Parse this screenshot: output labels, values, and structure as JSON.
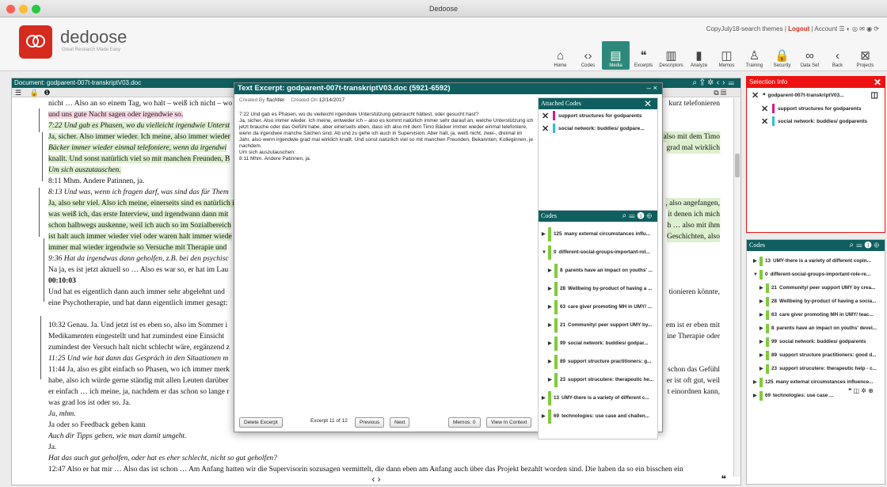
{
  "window": {
    "title": "Dedoose"
  },
  "app": {
    "logo_text": "dedoose",
    "tagline": "Great Research Made Easy"
  },
  "account_bar": {
    "project": "CopyJuly18-search themes",
    "sep1": "|",
    "logout": "Logout",
    "sep2": "|",
    "account": "Account",
    "icons": "☰ ◐ ◎ ✉ ◉ ⟳"
  },
  "toolbar": [
    {
      "label": "Home",
      "icon": "home-icon",
      "glyph": "⌂"
    },
    {
      "label": "Codes",
      "icon": "code-icon",
      "glyph": "‹›"
    },
    {
      "label": "Media",
      "icon": "media-icon",
      "glyph": "▤",
      "active": true
    },
    {
      "label": "Excerpts",
      "icon": "quote-icon",
      "glyph": "❝"
    },
    {
      "label": "Descriptors",
      "icon": "descriptor-icon",
      "glyph": "▥"
    },
    {
      "label": "Analyze",
      "icon": "chart-icon",
      "glyph": "▮"
    },
    {
      "label": "Memos",
      "icon": "memo-icon",
      "glyph": "◫"
    },
    {
      "label": "Training",
      "icon": "training-icon",
      "glyph": "♙"
    },
    {
      "label": "Security",
      "icon": "lock-icon",
      "glyph": "🔒"
    },
    {
      "label": "Data Set",
      "icon": "dataset-icon",
      "glyph": "∞"
    },
    {
      "label": "Back",
      "icon": "back-icon",
      "glyph": "‹"
    },
    {
      "label": "Projects",
      "icon": "projects-icon",
      "glyph": "⊠"
    }
  ],
  "document": {
    "title": "Document: godparent-007t-transkriptV03.doc",
    "lines": [
      {
        "text": "nicht … Also an so einem Tag, wo halt – weiß ich nicht – wo",
        "style": "plain",
        "right": "kurz telefonieren"
      },
      {
        "text": "und uns gute Nacht sagen oder irgendwie so.",
        "style": "pink"
      },
      {
        "text": "7:22 Und gab es Phasen, wo du vielleicht irgendwie Unterst",
        "style": "green-it"
      },
      {
        "text": "Ja, sicher. Also immer wieder. Ich meine, also immer wieder",
        "style": "green",
        "right": "also mit dem Timo"
      },
      {
        "text": "Bäcker immer wieder einmal telefoniere, wenn da irgendwi",
        "style": "green-it-part",
        "right": "grad mal wirklich"
      },
      {
        "text": "knallt. Und sonst natürlich viel so mit manchen Freunden, B",
        "style": "green"
      },
      {
        "text": "Um sich auszutauschen.",
        "style": "green-it"
      },
      {
        "text": "8:11 Mhm. Andere Patinnen, ja.",
        "style": "plain"
      },
      {
        "text": "8:13 Und was, wenn ich fragen darf, was sind das für Them",
        "style": "it"
      },
      {
        "text": "Ja, also sehr viel. Also ich meine, einerseits sind es natürlich i",
        "style": "green",
        "right": ", also angefangen,"
      },
      {
        "text": "was weiß ich, das erste Interview, und irgendwann dann mit",
        "style": "green",
        "right": "it denen ich mich"
      },
      {
        "text": "schon halbwegs auskenne, weil ich auch so im Sozialbereich",
        "style": "green",
        "right": "h … also mit ihm"
      },
      {
        "text": "ist halt auch immer wieder viel oder waren halt immer wiede",
        "style": "green",
        "right": "Geschichten, also"
      },
      {
        "text": "immer mal wieder irgendwie so Versuche mit Therapie und",
        "style": "green"
      },
      {
        "text": "9:36 Hat da irgendwas dann geholfen, z.B. bei den psychisc",
        "style": "it"
      },
      {
        "text": "Na ja, es ist jetzt aktuell so … Also es war so, er hat im Lau",
        "style": "plain"
      },
      {
        "text": "00:10:03",
        "style": "bold"
      },
      {
        "text": "Und hat es eigentlich dann auch immer sehr abgelehnt und",
        "style": "plain",
        "right": "tionieren könnte,"
      },
      {
        "text": "eine Psychotherapie, und hat dann eigentlich immer gesagt:",
        "style": "plain"
      },
      {
        "text": "",
        "style": "plain"
      },
      {
        "text": "10:32 Genau. Ja. Und jetzt ist es eben so, also im Sommer i",
        "style": "plain",
        "right": "em ist er eben mit"
      },
      {
        "text": "Medikamenten eingestellt und hat zumindest eine Einsicht",
        "style": "plain",
        "right": "ine Therapie oder"
      },
      {
        "text": "zumindest der Versuch halt nicht schlecht wäre, ergänzend z",
        "style": "plain"
      },
      {
        "text": "11:25 Und wie hat dann das Gespräch in den Situationen m",
        "style": "it"
      },
      {
        "text": "11:44 Ja, also es gibt einfach so Phasen, wo ich immer merk",
        "style": "plain",
        "right": "schon das Gefühl"
      },
      {
        "text": "habe, also ich würde gerne ständig mit allen Leuten darüber",
        "style": "plain",
        "right": "er ist oft gut, weil"
      },
      {
        "text": "er einfach … ich meine, ja, nachdem er das schon so lange r",
        "style": "plain",
        "right": "t einordnen kann,"
      },
      {
        "text": "was grad los ist oder so. Ja.",
        "style": "plain"
      },
      {
        "text": "Ja, mhm.",
        "style": "it"
      },
      {
        "text": "Ja oder so Feedback geben kann",
        "style": "plain"
      },
      {
        "text": "Auch dir Tipps geben, wie man damit umgeht.",
        "style": "it"
      },
      {
        "text": "Ja.",
        "style": "plain"
      },
      {
        "text": "Hat das auch gut geholfen, oder hat es eher schlecht, nicht so gut geholfen?",
        "style": "it"
      },
      {
        "text": "12:47 Also er hat mir … Also das ist schon … Am Anfang hatten wir die Supervisorin sozusagen vermittelt, die dann eben am Anfang auch über das Projekt bezahlt worden sind. Die haben da so ein bisschen ein",
        "style": "plain"
      }
    ],
    "pager": "‹   ›",
    "quote_icon": "❝"
  },
  "excerpt": {
    "title": "Text Excerpt:  godparent-007t-transkriptV03.doc (5921-6592)",
    "controls": "– ×",
    "created_by_label": "Created By",
    "created_by": "ftachtler",
    "created_on_label": "Created On",
    "created_on": "12/14/2017",
    "text": "7:22 Und gab es Phasen, wo du vielleicht irgendwie Unterstützung gebraucht hättest, oder gesucht hast?\nJa, sicher. Also immer wieder. Ich meine, entweder ich – also es kommt natürlich immer sehr darauf an, welche Unterstützung ich jetzt brauche oder das Gefühl habe, aber einerseits eben, dass ich also mit dem Timo Bäcker immer wieder einmal telefoniere, wenn da irgendwie manche Sachen sind. Ab und zu gehe ich auch in Supervision. Aber halt, ja, weiß nicht, zwei-, dreimal im Jahr, also wenn irgendwie grad mal wirklich knallt. Und sonst natürlich viel so mit manchen Freunden, Bekannten, Kolleginnen, je nachdem.\nUm sich auszutauschen.\n8:11 Mhm. Andere Patinnen, ja.",
    "attached_title": "Attached Codes",
    "attached": [
      {
        "label": "support structures for godparents",
        "color": "#d41a8a"
      },
      {
        "label": "social network: buddies/ godpare...",
        "color": "#2bc0d8"
      }
    ],
    "codes_title": "Codes",
    "codes": [
      {
        "count": "125",
        "label": "many external circumstances influ...",
        "indent": 0,
        "open": false
      },
      {
        "count": "0",
        "label": "different-social-groups-important-rol...",
        "indent": 0,
        "open": true
      },
      {
        "count": "8",
        "label": "parents have an impact on youths' ...",
        "indent": 1,
        "open": false
      },
      {
        "count": "28",
        "label": "Wellbeing by-product of having a ...",
        "indent": 1,
        "open": false
      },
      {
        "count": "63",
        "label": "care giver promoting MH in UMY/ ...",
        "indent": 1,
        "open": false
      },
      {
        "count": "21",
        "label": "Community/ peer support UMY by...",
        "indent": 1,
        "open": false
      },
      {
        "count": "99",
        "label": "social network: buddies/ godpar...",
        "indent": 1,
        "open": false
      },
      {
        "count": "89",
        "label": "support structure practitioners: g...",
        "indent": 1,
        "open": false
      },
      {
        "count": "23",
        "label": "support strucutere: therapeutic he...",
        "indent": 1,
        "open": false
      },
      {
        "count": "13",
        "label": "UMY-there is a variety of different c...",
        "indent": 0,
        "open": false
      },
      {
        "count": "69",
        "label": "technologies: use case and challen...",
        "indent": 0,
        "open": false
      }
    ],
    "buttons": {
      "delete": "Delete Excerpt",
      "counter": "Excerpt 11 of 12",
      "previous": "Previous",
      "next": "Next",
      "memos": "Memos: 0",
      "view": "View In Context"
    }
  },
  "selection": {
    "title": "Selection Info",
    "doc": "godparent-007t-transkriptV03...",
    "codes": [
      {
        "label": "support structures for godparents",
        "color": "#d41a8a"
      },
      {
        "label": "social network: buddies/ godparents",
        "color": "#2bc0d8"
      }
    ]
  },
  "right_codes": {
    "title": "Codes",
    "rows": [
      {
        "count": "13",
        "label": "UMY-there is a variety of different copin...",
        "indent": 0,
        "open": false
      },
      {
        "count": "0",
        "label": "different-social-groups-important-role-re...",
        "indent": 0,
        "open": true
      },
      {
        "count": "21",
        "label": "Community/ peer support UMY by crea...",
        "indent": 1,
        "open": false
      },
      {
        "count": "28",
        "label": "Wellbeing by-product of having a socia...",
        "indent": 1,
        "open": false
      },
      {
        "count": "63",
        "label": "care giver promoting MH in UMY/ teac...",
        "indent": 1,
        "open": false
      },
      {
        "count": "8",
        "label": "parents have an impact on youths' devel...",
        "indent": 1,
        "open": false
      },
      {
        "count": "99",
        "label": "social network: buddies/ godparents",
        "indent": 1,
        "open": false
      },
      {
        "count": "89",
        "label": "support structure practitioners: good d...",
        "indent": 1,
        "open": false
      },
      {
        "count": "23",
        "label": "support strucutere: therapeutic help - c...",
        "indent": 1,
        "open": false
      },
      {
        "count": "125",
        "label": "many external circumstances influence...",
        "indent": 0,
        "open": false
      },
      {
        "count": "69",
        "label": "technologies: use case ...",
        "indent": 0,
        "open": false
      }
    ]
  }
}
